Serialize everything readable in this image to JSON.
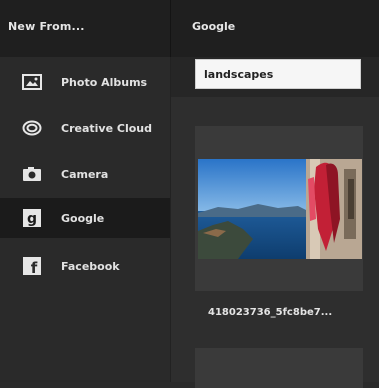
{
  "header": {
    "left_title": "New From...",
    "right_title": "Google"
  },
  "sidebar": {
    "items": [
      {
        "label": "Photo Albums",
        "icon": "photo-albums-icon",
        "active": false
      },
      {
        "label": "Creative Cloud",
        "icon": "creative-cloud-icon",
        "active": false
      },
      {
        "label": "Camera",
        "icon": "camera-icon",
        "active": false
      },
      {
        "label": "Google",
        "icon": "google-icon",
        "active": true
      },
      {
        "label": "Facebook",
        "icon": "facebook-icon",
        "active": false
      }
    ]
  },
  "search": {
    "value": "landscapes"
  },
  "results": [
    {
      "caption": "418023736_5fc8be7..."
    }
  ],
  "colors": {
    "background": "#2b2b2b",
    "header": "#1f1f1f",
    "active_item": "#1b1b1b",
    "card": "#3a3a3a"
  }
}
